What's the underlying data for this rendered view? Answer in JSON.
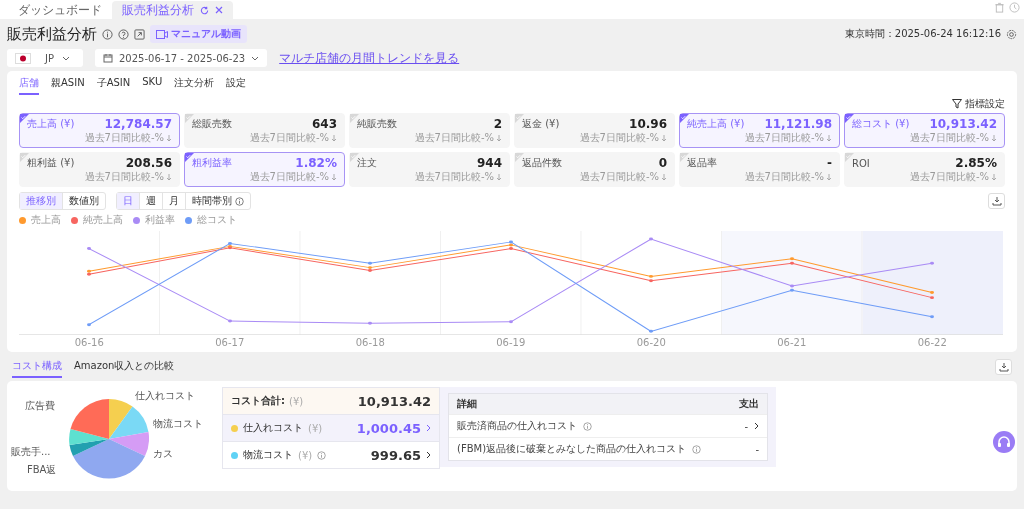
{
  "page_tabs": [
    {
      "label": "ダッシュボード",
      "selected": false
    },
    {
      "label": "販売利益分析",
      "selected": true
    }
  ],
  "header": {
    "title": "販売利益分析",
    "video_button": "マニュアル動画",
    "clock": "東京時間：2025-06-24 16:12:16"
  },
  "filters": {
    "marketplace": "JP",
    "date_range": "2025-06-17 - 2025-06-23",
    "link": "マルチ店舗の月間トレンドを見る"
  },
  "tabs": [
    {
      "label": "店舗",
      "selected": true
    },
    {
      "label": "親ASIN",
      "selected": false
    },
    {
      "label": "子ASIN",
      "selected": false
    },
    {
      "label": "SKU",
      "selected": false
    },
    {
      "label": "注文分析",
      "selected": false
    },
    {
      "label": "設定",
      "selected": false
    }
  ],
  "metric_settings": "指標設定",
  "metrics": [
    {
      "label": "売上高 (¥)",
      "value": "12,784.57",
      "compare": "過去7日間比較-%",
      "selected": true
    },
    {
      "label": "総販売数",
      "value": "643",
      "compare": "過去7日間比較-%",
      "selected": false
    },
    {
      "label": "純販売数",
      "value": "2",
      "compare": "過去7日間比較-%",
      "selected": false
    },
    {
      "label": "返金 (¥)",
      "value": "10.96",
      "compare": "過去7日間比較-%",
      "selected": false
    },
    {
      "label": "純売上高 (¥)",
      "value": "11,121.98",
      "compare": "過去7日間比較-%",
      "selected": true
    },
    {
      "label": "総コスト (¥)",
      "value": "10,913.42",
      "compare": "過去7日間比較-%",
      "selected": true
    },
    {
      "label": "粗利益 (¥)",
      "value": "208.56",
      "compare": "過去7日間比較-%",
      "selected": false
    },
    {
      "label": "粗利益率",
      "value": "1.82%",
      "compare": "過去7日間比較-%",
      "selected": true
    },
    {
      "label": "注文",
      "value": "944",
      "compare": "過去7日間比較-%",
      "selected": false
    },
    {
      "label": "返品件数",
      "value": "0",
      "compare": "過去7日間比較-%",
      "selected": false
    },
    {
      "label": "返品率",
      "value": "-",
      "compare": "過去7日間比較-%",
      "selected": false
    },
    {
      "label": "ROI",
      "value": "2.85%",
      "compare": "過去7日間比較-%",
      "selected": false
    }
  ],
  "view_toggle": [
    {
      "label": "推移別",
      "selected": true
    },
    {
      "label": "数値別",
      "selected": false
    }
  ],
  "period_toggle": [
    {
      "label": "日",
      "selected": true
    },
    {
      "label": "週",
      "selected": false
    },
    {
      "label": "月",
      "selected": false
    },
    {
      "label": "時間帯別",
      "selected": false
    }
  ],
  "legend": [
    {
      "name": "売上高",
      "color": "#ff9a2e"
    },
    {
      "name": "純売上高",
      "color": "#f76560"
    },
    {
      "name": "利益率",
      "color": "#a98bf5"
    },
    {
      "name": "総コスト",
      "color": "#6e9cf7"
    }
  ],
  "x_labels": [
    "06-16",
    "06-17",
    "06-18",
    "06-19",
    "06-20",
    "06-21",
    "06-22"
  ],
  "lower_tabs": [
    {
      "label": "コスト構成",
      "selected": true
    },
    {
      "label": "Amazon収入との比較",
      "selected": false
    }
  ],
  "pie_labels": [
    "広告費",
    "仕入れコスト",
    "物流コスト",
    "カス",
    "販売手...",
    "FBA返"
  ],
  "cost_total": {
    "label": "コスト合計:",
    "unit": "(¥)",
    "value": "10,913.42"
  },
  "cost_rows": [
    {
      "label": "仕入れコスト",
      "unit": "(¥)",
      "value": "1,000.45",
      "color": "#f5cf4f",
      "selected": true,
      "info": false
    },
    {
      "label": "物流コスト",
      "unit": "(¥)",
      "value": "999.65",
      "color": "#5fd2f5",
      "selected": false,
      "info": true
    }
  ],
  "detail": {
    "columns": [
      "詳細",
      "支出"
    ],
    "rows": [
      {
        "label": "販売済商品の仕入れコスト",
        "value": "-",
        "link": true
      },
      {
        "label": "(FBM)返品後に破棄とみなした商品の仕入れコスト",
        "value": "-",
        "link": false
      }
    ]
  }
}
